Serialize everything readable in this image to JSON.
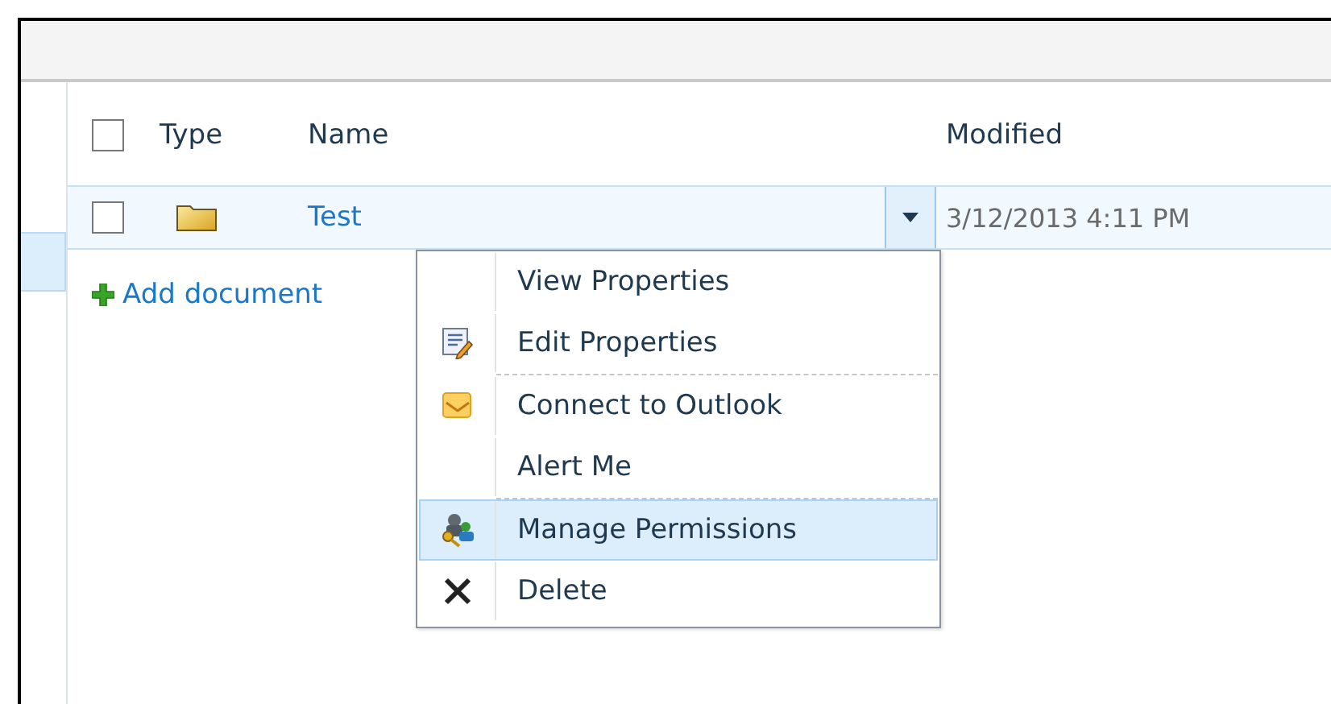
{
  "table": {
    "columns": [
      {
        "label": "Type"
      },
      {
        "label": "Name"
      },
      {
        "label": "Modified"
      }
    ],
    "select_all": {
      "checked": false
    },
    "rows": [
      {
        "checked": false,
        "selected": true,
        "name": "Test",
        "modified": "3/12/2013 4:11 PM"
      }
    ]
  },
  "add_link": {
    "label": "Add document"
  },
  "context_menu": {
    "items": [
      {
        "label": "View Properties",
        "kind": "none",
        "selected": false,
        "separator_after": false
      },
      {
        "label": "Edit Properties",
        "kind": "edit",
        "selected": false,
        "separator_after": true
      },
      {
        "label": "Connect to Outlook",
        "kind": "outlook",
        "selected": false,
        "separator_after": false
      },
      {
        "label": "Alert Me",
        "kind": "none",
        "selected": false,
        "separator_after": true
      },
      {
        "label": "Manage Permissions",
        "kind": "permissions",
        "selected": true,
        "separator_after": false
      },
      {
        "label": "Delete",
        "kind": "delete",
        "selected": false,
        "separator_after": false
      }
    ]
  }
}
